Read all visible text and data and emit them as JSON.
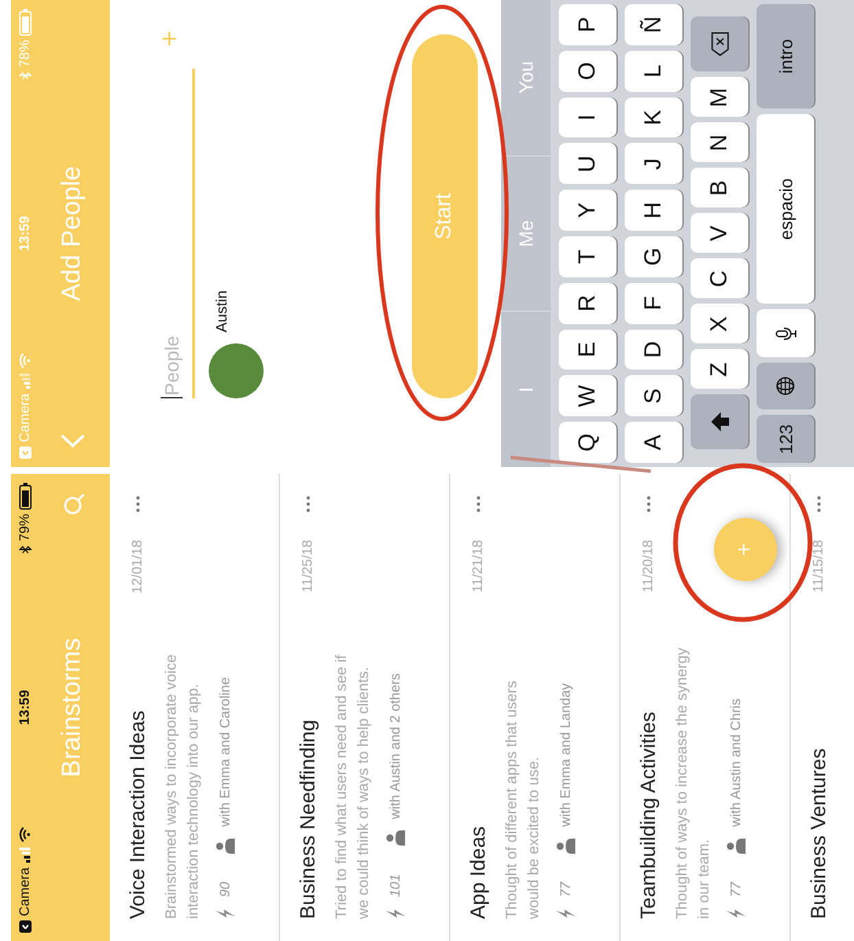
{
  "brainstorms_screen": {
    "status_bar": {
      "carrier": "Camera",
      "time": "13:59",
      "battery": "79%"
    },
    "title": "Brainstorms",
    "cards": [
      {
        "title": "Voice Interaction Ideas",
        "date": "12/01/18",
        "description": "Brainstormed ways to incorporate voice interaction technology into our app.",
        "score": "90",
        "collaborators": "with Emma and Caroline"
      },
      {
        "title": "Business Needfinding",
        "date": "11/25/18",
        "description": "Tried to find what users need and see if we could think of ways to help clients.",
        "score": "101",
        "collaborators": "with Austin and 2 others"
      },
      {
        "title": "App Ideas",
        "date": "11/21/18",
        "description": "Thought of different apps that users would be excited to use.",
        "score": "77",
        "collaborators": "with Emma and Landay"
      },
      {
        "title": "Teambuilding Activities",
        "date": "11/20/18",
        "description": "Thought of ways to increase the synergy in our team.",
        "score": "77",
        "collaborators": "with Austin and Chris"
      },
      {
        "title": "Business Ventures",
        "date": "11/15/18"
      }
    ],
    "fab_label": "+"
  },
  "add_people_screen": {
    "status_bar": {
      "carrier": "Camera",
      "time": "13:59",
      "battery": "78%"
    },
    "title": "Add People",
    "people_field": {
      "placeholder": "People"
    },
    "add_label": "+",
    "people": [
      {
        "name": "Austin"
      }
    ],
    "start_button": "Start",
    "keyboard": {
      "suggestions": [
        "I",
        "Me",
        "You"
      ],
      "rows": [
        {
          "keys": [
            {
              "kind": "letter",
              "label": "Q"
            },
            {
              "kind": "letter",
              "label": "W"
            },
            {
              "kind": "letter",
              "label": "E"
            },
            {
              "kind": "letter",
              "label": "R"
            },
            {
              "kind": "letter",
              "label": "T"
            },
            {
              "kind": "letter",
              "label": "Y"
            },
            {
              "kind": "letter",
              "label": "U"
            },
            {
              "kind": "letter",
              "label": "I"
            },
            {
              "kind": "letter",
              "label": "O"
            },
            {
              "kind": "letter",
              "label": "P"
            }
          ]
        },
        {
          "keys": [
            {
              "kind": "letter",
              "label": "A"
            },
            {
              "kind": "letter",
              "label": "S"
            },
            {
              "kind": "letter",
              "label": "D"
            },
            {
              "kind": "letter",
              "label": "F"
            },
            {
              "kind": "letter",
              "label": "G"
            },
            {
              "kind": "letter",
              "label": "H"
            },
            {
              "kind": "letter",
              "label": "J"
            },
            {
              "kind": "letter",
              "label": "K"
            },
            {
              "kind": "letter",
              "label": "L"
            },
            {
              "kind": "letter",
              "label": "Ñ"
            }
          ]
        },
        {
          "keys": [
            {
              "kind": "shift"
            },
            {
              "kind": "letter",
              "label": "Z"
            },
            {
              "kind": "letter",
              "label": "X"
            },
            {
              "kind": "letter",
              "label": "C"
            },
            {
              "kind": "letter",
              "label": "V"
            },
            {
              "kind": "letter",
              "label": "B"
            },
            {
              "kind": "letter",
              "label": "N"
            },
            {
              "kind": "letter",
              "label": "M"
            },
            {
              "kind": "delete"
            }
          ]
        },
        {
          "keys": [
            {
              "kind": "numbers",
              "label": "123"
            },
            {
              "kind": "globe"
            },
            {
              "kind": "mic"
            },
            {
              "kind": "space",
              "label": "espacio"
            },
            {
              "kind": "return",
              "label": "intro"
            }
          ]
        }
      ]
    }
  }
}
